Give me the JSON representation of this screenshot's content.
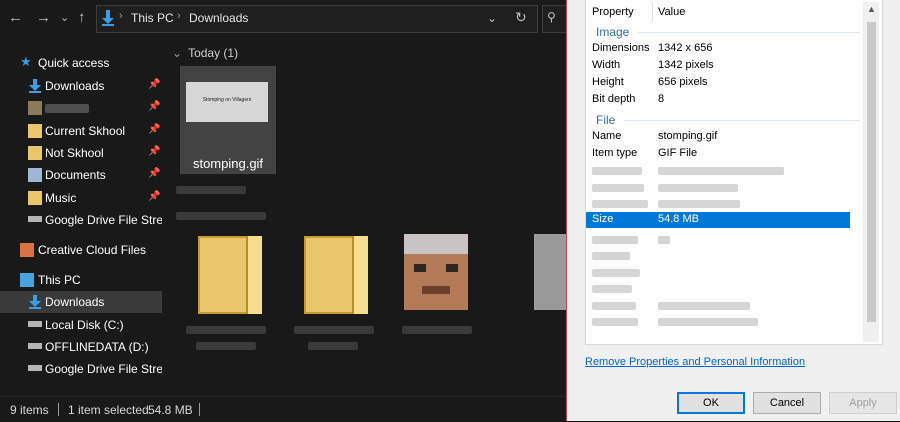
{
  "explorer": {
    "breadcrumb": [
      "This PC",
      "Downloads"
    ],
    "group_heading": "Today (1)",
    "selected_file": {
      "name": "stomping.gif",
      "thumb_caption": "Stomping on Villagers"
    },
    "status": {
      "items": "9 items",
      "selected": "1 item selected",
      "size": "54.8 MB"
    }
  },
  "sidebar": {
    "items": [
      {
        "label": "Quick access",
        "icon": "star-icon"
      },
      {
        "label": "Downloads",
        "icon": "download-arrow-icon",
        "pinned": true
      },
      {
        "label": "",
        "icon": "folder-icon",
        "pinned": true,
        "blurred": true
      },
      {
        "label": "Current Skhool",
        "icon": "folder-icon",
        "pinned": true
      },
      {
        "label": "Not Skhool",
        "icon": "folder-icon",
        "pinned": true
      },
      {
        "label": "Documents",
        "icon": "documents-icon",
        "pinned": true
      },
      {
        "label": "Music",
        "icon": "music-folder-icon",
        "pinned": true
      },
      {
        "label": "Google Drive File Stre",
        "icon": "drive-icon"
      },
      {
        "label": "Creative Cloud Files",
        "icon": "creative-cloud-folder-icon"
      },
      {
        "label": "This PC",
        "icon": "computer-icon"
      },
      {
        "label": "Downloads",
        "icon": "download-arrow-icon",
        "selected": true
      },
      {
        "label": "Local Disk (C:)",
        "icon": "drive-icon"
      },
      {
        "label": "OFFLINEDATA (D:)",
        "icon": "drive-icon"
      },
      {
        "label": "Google Drive File Stream",
        "icon": "drive-icon"
      }
    ]
  },
  "dialog": {
    "col_property": "Property",
    "col_value": "Value",
    "image_section": "Image",
    "image_props": [
      {
        "k": "Dimensions",
        "v": "1342 x 656"
      },
      {
        "k": "Width",
        "v": "1342 pixels"
      },
      {
        "k": "Height",
        "v": "656 pixels"
      },
      {
        "k": "Bit depth",
        "v": "8"
      }
    ],
    "file_section": "File",
    "file_props": [
      {
        "k": "Name",
        "v": "stomping.gif"
      },
      {
        "k": "Item type",
        "v": "GIF File"
      }
    ],
    "size_prop": {
      "k": "Size",
      "v": "54.8 MB"
    },
    "remove_link": "Remove Properties and Personal Information",
    "buttons": {
      "ok": "OK",
      "cancel": "Cancel",
      "apply": "Apply"
    }
  },
  "colors": {
    "accent": "#0078d7",
    "explorer_bg": "#191919",
    "dialog_bg": "#f0f0f0",
    "link": "#0066cc"
  }
}
